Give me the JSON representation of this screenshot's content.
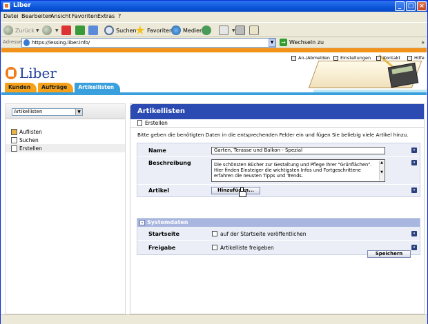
{
  "window": {
    "title": "Liber"
  },
  "menu": [
    "Datei",
    "Bearbeiten",
    "Ansicht",
    "Favoriten",
    "Extras",
    "?"
  ],
  "toolbar": {
    "back": "Zurück",
    "search": "Suchen",
    "favorites": "Favoriten",
    "media": "Medien"
  },
  "address": {
    "label": "Adresse",
    "url": "https://lessing.liber.info/",
    "go": "Wechseln zu",
    "links": "»"
  },
  "site": {
    "logo": "Liber",
    "utility": [
      "An-/Abmelden",
      "Einstellungen",
      "Kontakt",
      "Hilfe"
    ],
    "tabs": [
      "Kunden",
      "Aufträge",
      "Artikellisten"
    ]
  },
  "sidebar": {
    "select_value": "Artikellisten",
    "items": [
      "Auflisten",
      "Suchen",
      "Erstellen"
    ]
  },
  "main": {
    "title": "Artikellisten",
    "subnav": "Erstellen",
    "intro": "Bitte geben die benötigten Daten in die entsprechenden Felder ein und fügen Sie beliebig viele Artikel hinzu.",
    "name_label": "Name",
    "name_value": "Garten, Terasse und Balkon - Spezial",
    "desc_label": "Beschreibung",
    "desc_value": "Die schönsten Bücher zur Gestaltung und Pflege Ihrer \"Grünflächen\". Hier finden Einsteiger die wichtigsten Infos und Fortgeschrittene erfahren die neusten Tipps und Trends.",
    "articles_label": "Artikel",
    "add_button": "Hinzufügen...",
    "section_title": "Systemdaten",
    "section_toggle": "-",
    "start_label": "Startseite",
    "start_check": "auf der Startseite veröffentlichen",
    "release_label": "Freigabe",
    "release_check": "Artikelliste freigeben",
    "save_button": "Speichern",
    "more": "▾"
  }
}
